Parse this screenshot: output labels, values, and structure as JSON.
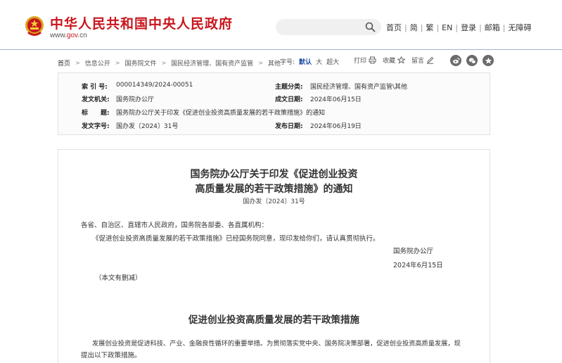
{
  "site": {
    "title": "中华人民共和国中央人民政府",
    "url_prefix": "www.",
    "url_highlight": "gov",
    "url_suffix": ".cn"
  },
  "topnav": [
    "首页",
    "简",
    "繁",
    "EN",
    "登录",
    "邮箱",
    "无障碍"
  ],
  "breadcrumb": [
    "首页",
    "信息公开",
    "国务院文件",
    "国民经济管理、国有资产监管",
    "其他"
  ],
  "fontsize": {
    "label": "字号:",
    "options": [
      "默认",
      "大",
      "超大"
    ]
  },
  "tools": {
    "print": "打印",
    "favorite": "收藏",
    "comment": "留言"
  },
  "info": {
    "index_label": "索 引 号:",
    "index_value": "000014349/2024-00051",
    "category_label": "主题分类:",
    "category_value": "国民经济管理、国有资产监管\\其他",
    "issuer_label": "发文机关:",
    "issuer_value": "国务院办公厅",
    "created_label": "成文日期:",
    "created_value": "2024年06月15日",
    "title_label": "标　　题:",
    "title_value": "国务院办公厅关于印发《促进创业投资高质量发展的若干政策措施》的通知",
    "docno_label": "发文字号:",
    "docno_value": "国办发〔2024〕31号",
    "published_label": "发布日期:",
    "published_value": "2024年06月19日"
  },
  "document": {
    "title_line1": "国务院办公厅关于印发《促进创业投资",
    "title_line2": "高质量发展的若干政策措施》的通知",
    "number": "国办发〔2024〕31号",
    "salutation": "各省、自治区、直辖市人民政府，国务院各部委、各直属机构：",
    "body1": "《促进创业投资高质量发展的若干政策措施》已经国务院同意，现印发给你们，请认真贯彻执行。",
    "signatory": "国务院办公厅",
    "date": "2024年6月15日",
    "note": "（本文有删减）",
    "section_title": "促进创业投资高质量发展的若干政策措施",
    "para1_line1": "发展创业投资是促进科技、产业、金融良性循环的重要举措。为贯彻落实党中央、国务院决策部署，促进创业投资高质量发展，现",
    "para1_line2": "提出以下政策措施。"
  },
  "colors": {
    "brand_red": "#c8161d",
    "link_blue": "#1f4ea1",
    "rule_blue": "#9db3d0"
  }
}
